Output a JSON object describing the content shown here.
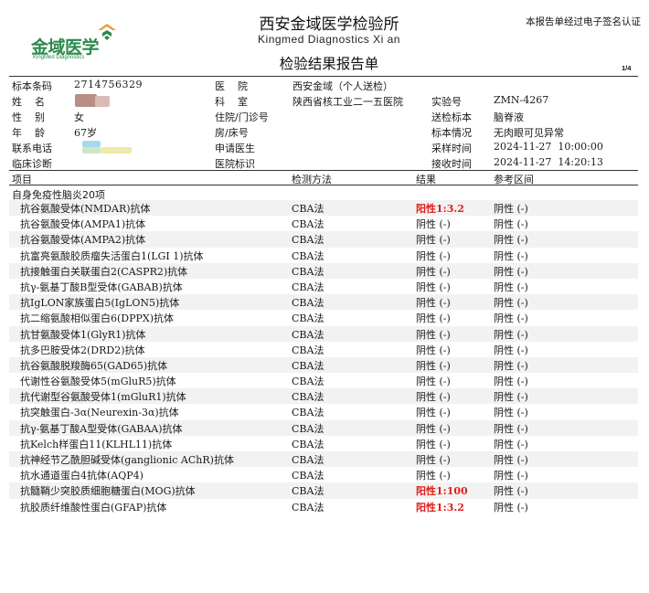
{
  "header": {
    "logo_cn": "金域医学",
    "logo_en": "KingMed Diagnostics",
    "org_cn": "西安金域医学检验所",
    "org_en": "Kingmed Diagnostics Xi an",
    "report_title": "检验结果报告单",
    "e_sign": "本报告单经过电子签名认证",
    "page_no": "1/4"
  },
  "patient": {
    "barcode_label": "标本条码",
    "barcode": "2714756329",
    "name_label": "姓    名",
    "gender_label": "性    别",
    "gender": "女",
    "age_label": "年    龄",
    "age": "67岁",
    "phone_label": "联系电话",
    "diagnosis_label": "临床诊断",
    "hospital_label": "医    院",
    "hospital": "西安金域（个人送检）",
    "dept_label": "科    室",
    "dept": "陕西省核工业二一五医院",
    "inpatient_label": "住院/门诊号",
    "bed_label": "房/床号",
    "doctor_label": "申请医生",
    "hospital_id_label": "医院标识",
    "lab_no_label": "实验号",
    "lab_no": "ZMN-4267",
    "sample_type_label": "送检标本",
    "sample_type": "脑脊液",
    "sample_cond_label": "标本情况",
    "sample_cond": "无肉眼可见异常",
    "collect_label": "采样时间",
    "collect_time": "2024-11-27  10:00:00",
    "receive_label": "接收时间",
    "receive_time": "2024-11-27  14:20:13"
  },
  "columns": {
    "item": "项目",
    "method": "检测方法",
    "result": "结果",
    "ref": "参考区间"
  },
  "section_title": "自身免疫性脑炎20项",
  "rows": [
    {
      "name": "抗谷氨酸受体(NMDAR)抗体",
      "method": "CBA法",
      "result": "阳性1:3.2",
      "ref": "阴性 (-)",
      "abnormal": true
    },
    {
      "name": "抗谷氨酸受体(AMPA1)抗体",
      "method": "CBA法",
      "result": "阴性 (-)",
      "ref": "阴性 (-)",
      "abnormal": false
    },
    {
      "name": "抗谷氨酸受体(AMPA2)抗体",
      "method": "CBA法",
      "result": "阴性 (-)",
      "ref": "阴性 (-)",
      "abnormal": false
    },
    {
      "name": "抗富亮氨酸胶质瘤失活蛋白1(LGI 1)抗体",
      "method": "CBA法",
      "result": "阴性 (-)",
      "ref": "阴性 (-)",
      "abnormal": false
    },
    {
      "name": "抗接触蛋白关联蛋白2(CASPR2)抗体",
      "method": "CBA法",
      "result": "阴性 (-)",
      "ref": "阴性 (-)",
      "abnormal": false
    },
    {
      "name": "抗γ-氨基丁酸B型受体(GABAB)抗体",
      "method": "CBA法",
      "result": "阴性 (-)",
      "ref": "阴性 (-)",
      "abnormal": false
    },
    {
      "name": "抗IgLON家族蛋白5(IgLON5)抗体",
      "method": "CBA法",
      "result": "阴性 (-)",
      "ref": "阴性 (-)",
      "abnormal": false
    },
    {
      "name": "抗二缩氨酸相似蛋白6(DPPX)抗体",
      "method": "CBA法",
      "result": "阴性 (-)",
      "ref": "阴性 (-)",
      "abnormal": false
    },
    {
      "name": "抗甘氨酸受体1(GlyR1)抗体",
      "method": "CBA法",
      "result": "阴性 (-)",
      "ref": "阴性 (-)",
      "abnormal": false
    },
    {
      "name": "抗多巴胺受体2(DRD2)抗体",
      "method": "CBA法",
      "result": "阴性 (-)",
      "ref": "阴性 (-)",
      "abnormal": false
    },
    {
      "name": "抗谷氨酸脱羧酶65(GAD65)抗体",
      "method": "CBA法",
      "result": "阴性 (-)",
      "ref": "阴性 (-)",
      "abnormal": false
    },
    {
      "name": "代谢性谷氨酸受体5(mGluR5)抗体",
      "method": "CBA法",
      "result": "阴性 (-)",
      "ref": "阴性 (-)",
      "abnormal": false
    },
    {
      "name": "抗代谢型谷氨酸受体1(mGluR1)抗体",
      "method": "CBA法",
      "result": "阴性 (-)",
      "ref": "阴性 (-)",
      "abnormal": false
    },
    {
      "name": "抗突触蛋白-3α(Neurexin-3α)抗体",
      "method": "CBA法",
      "result": "阴性 (-)",
      "ref": "阴性 (-)",
      "abnormal": false
    },
    {
      "name": "抗γ-氨基丁酸A型受体(GABAA)抗体",
      "method": "CBA法",
      "result": "阴性 (-)",
      "ref": "阴性 (-)",
      "abnormal": false
    },
    {
      "name": "抗Kelch样蛋白11(KLHL11)抗体",
      "method": "CBA法",
      "result": "阴性 (-)",
      "ref": "阴性 (-)",
      "abnormal": false
    },
    {
      "name": "抗神经节乙酰胆碱受体(ganglionic AChR)抗体",
      "method": "CBA法",
      "result": "阴性 (-)",
      "ref": "阴性 (-)",
      "abnormal": false
    },
    {
      "name": "抗水通道蛋白4抗体(AQP4)",
      "method": "CBA法",
      "result": "阴性 (-)",
      "ref": "阴性 (-)",
      "abnormal": false
    },
    {
      "name": "抗髓鞘少突胶质细胞糖蛋白(MOG)抗体",
      "method": "CBA法",
      "result": "阳性1:100",
      "ref": "阴性 (-)",
      "abnormal": true
    },
    {
      "name": "抗胶质纤维酸性蛋白(GFAP)抗体",
      "method": "CBA法",
      "result": "阳性1:3.2",
      "ref": "阴性 (-)",
      "abnormal": true
    }
  ],
  "colors": {
    "brand": "#2b8a4b",
    "logo_accent": "#e2a13a",
    "abnormal": "#e0201c"
  },
  "icons": {
    "logo_mark": "kingmed-chevron-icon"
  }
}
